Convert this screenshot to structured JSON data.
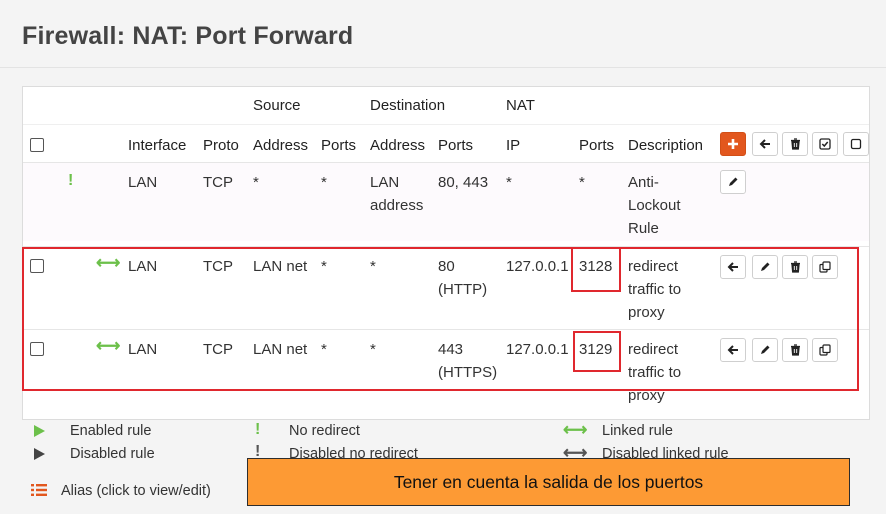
{
  "page": {
    "title": "Firewall: NAT: Port Forward"
  },
  "table": {
    "group_headers": {
      "source": "Source",
      "destination": "Destination",
      "nat": "NAT"
    },
    "columns": {
      "interface": "Interface",
      "proto": "Proto",
      "src_address": "Address",
      "src_ports": "Ports",
      "dst_address": "Address",
      "dst_ports": "Ports",
      "nat_ip": "IP",
      "nat_ports": "Ports",
      "description": "Description"
    },
    "rows": [
      {
        "status_symbol": "!",
        "interface": "LAN",
        "proto": "TCP",
        "src_address": "*",
        "src_ports": "*",
        "dst_address_1": "LAN",
        "dst_address_2": "address",
        "dst_ports_1": "80, 443",
        "dst_ports_2": "",
        "nat_ip": "*",
        "nat_ports": "*",
        "desc_1": "Anti-",
        "desc_2": "Lockout",
        "desc_3": "Rule"
      },
      {
        "status_symbol": "⟷",
        "interface": "LAN",
        "proto": "TCP",
        "src_address": "LAN net",
        "src_ports": "*",
        "dst_address_1": "*",
        "dst_address_2": "",
        "dst_ports_1": "80",
        "dst_ports_2": "(HTTP)",
        "nat_ip": "127.0.0.1",
        "nat_ports": "3128",
        "desc_1": "redirect",
        "desc_2": "traffic to",
        "desc_3": "proxy"
      },
      {
        "status_symbol": "⟷",
        "interface": "LAN",
        "proto": "TCP",
        "src_address": "LAN net",
        "src_ports": "*",
        "dst_address_1": "*",
        "dst_address_2": "",
        "dst_ports_1": "443",
        "dst_ports_2": "(HTTPS)",
        "nat_ip": "127.0.0.1",
        "nat_ports": "3129",
        "desc_1": "redirect",
        "desc_2": "traffic to",
        "desc_3": "proxy"
      }
    ]
  },
  "legend": {
    "enabled": "Enabled rule",
    "disabled": "Disabled rule",
    "no_redirect": "No redirect",
    "disabled_no_redirect": "Disabled no redirect",
    "linked": "Linked rule",
    "disabled_linked": "Disabled linked rule",
    "alias": "Alias (click to view/edit)"
  },
  "callout": {
    "text": "Tener en cuenta la salida de los puertos"
  },
  "colors": {
    "accent_orange": "#e2571e",
    "green": "#6cc04a",
    "highlight_red": "#e0282e",
    "callout_bg": "#fd9a34"
  },
  "icons": {
    "add": "plus-icon",
    "move": "arrow-left-icon",
    "delete": "trash-icon",
    "toggle": "check-square-icon",
    "select": "square-icon",
    "edit": "pencil-icon",
    "copy": "copy-icon",
    "alias": "list-icon"
  }
}
